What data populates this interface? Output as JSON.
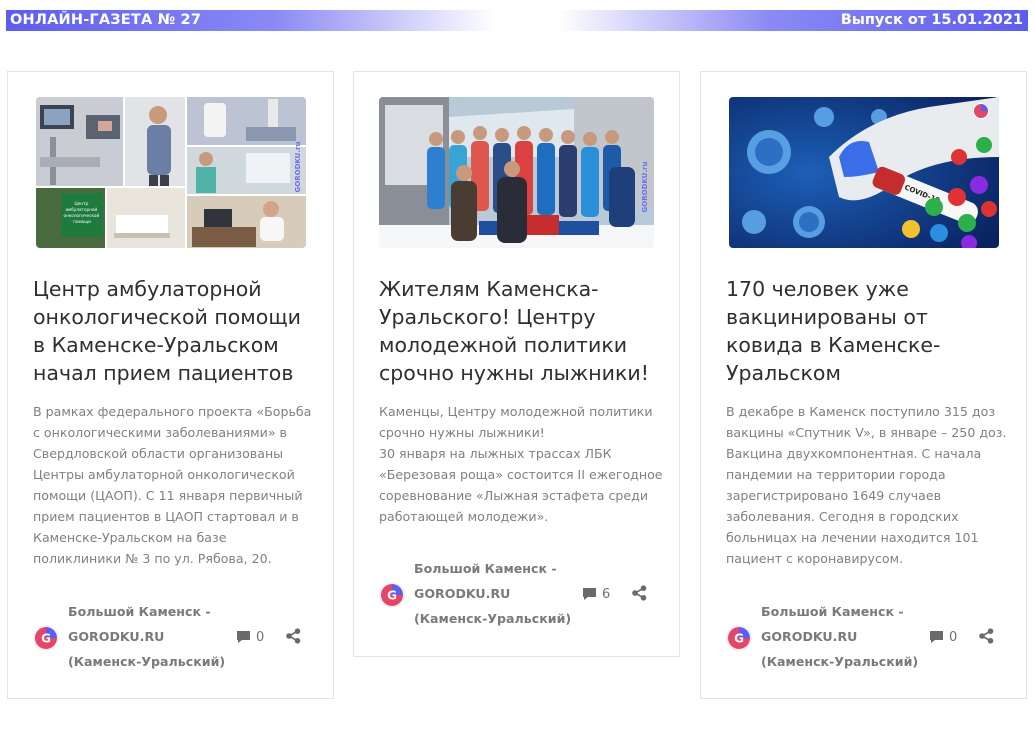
{
  "header": {
    "title": "ОНЛАЙН-ГАЗЕТА № 27",
    "issue_date": "Выпуск от 15.01.2021"
  },
  "cards": [
    {
      "title": "Центр амбулаторной онкологической помощи в Каменске-Уральском начал прием пациентов",
      "excerpt": "В рамках федерального проекта «Борьба с онкологическими заболеваниями» в Свердловской области организованы Центры амбулаторной онкологической помощи (ЦАОП). С 11 января первичный прием пациентов в ЦАОП стартовал и в Каменске-Уральском на базе поликлиники № 3 по ул. Рябова, 20.",
      "author": "Большой Каменск - GORODKU.RU (Каменск-Уральский)",
      "comments": "0",
      "image_icon": "clinic-photo-collage",
      "sign_text": "Центр амбулаторной онкологической помощи"
    },
    {
      "title": "Жителям Каменска-Уральского! Центру молодежной политики срочно нужны лыжники!",
      "excerpt": "Каменцы, Центру молодежной политики срочно нужны лыжники!\n30 января на лыжных трассах ЛБК «Березовая роща» состоится II ежегодное соревнование «Лыжная эстафета среди работающей молодежи».",
      "author": "Большой Каменск - GORODKU.RU (Каменск-Уральский)",
      "comments": "6",
      "image_icon": "skiers-podium-photo"
    },
    {
      "title": "170 человек уже вакцинированы от ковида в Каменске-Уральском",
      "excerpt": "В декабре в Каменск поступило 315 доз вакцины «Спутник V», в январе – 250 доз. Вакцина двухкомпонентная. С начала пандемии на территории города зарегистрировано 1649 случаев заболевания. Сегодня в городских больницах на лечении находится 101 пациент с коронавирусом.",
      "author": "Большой Каменск - GORODKU.RU (Каменск-Уральский)",
      "comments": "0",
      "image_icon": "covid-test-tube-photo",
      "tube_label": "COVID-19"
    }
  ],
  "watermark": "GORODKU.ru",
  "colors": {
    "banner": "#5d5cf0",
    "title_text": "#2f2f2f",
    "excerpt_text": "#808080",
    "icon_gray": "#6a6a6a",
    "avatar_a": "#e64568",
    "avatar_b": "#5a5ff0"
  }
}
